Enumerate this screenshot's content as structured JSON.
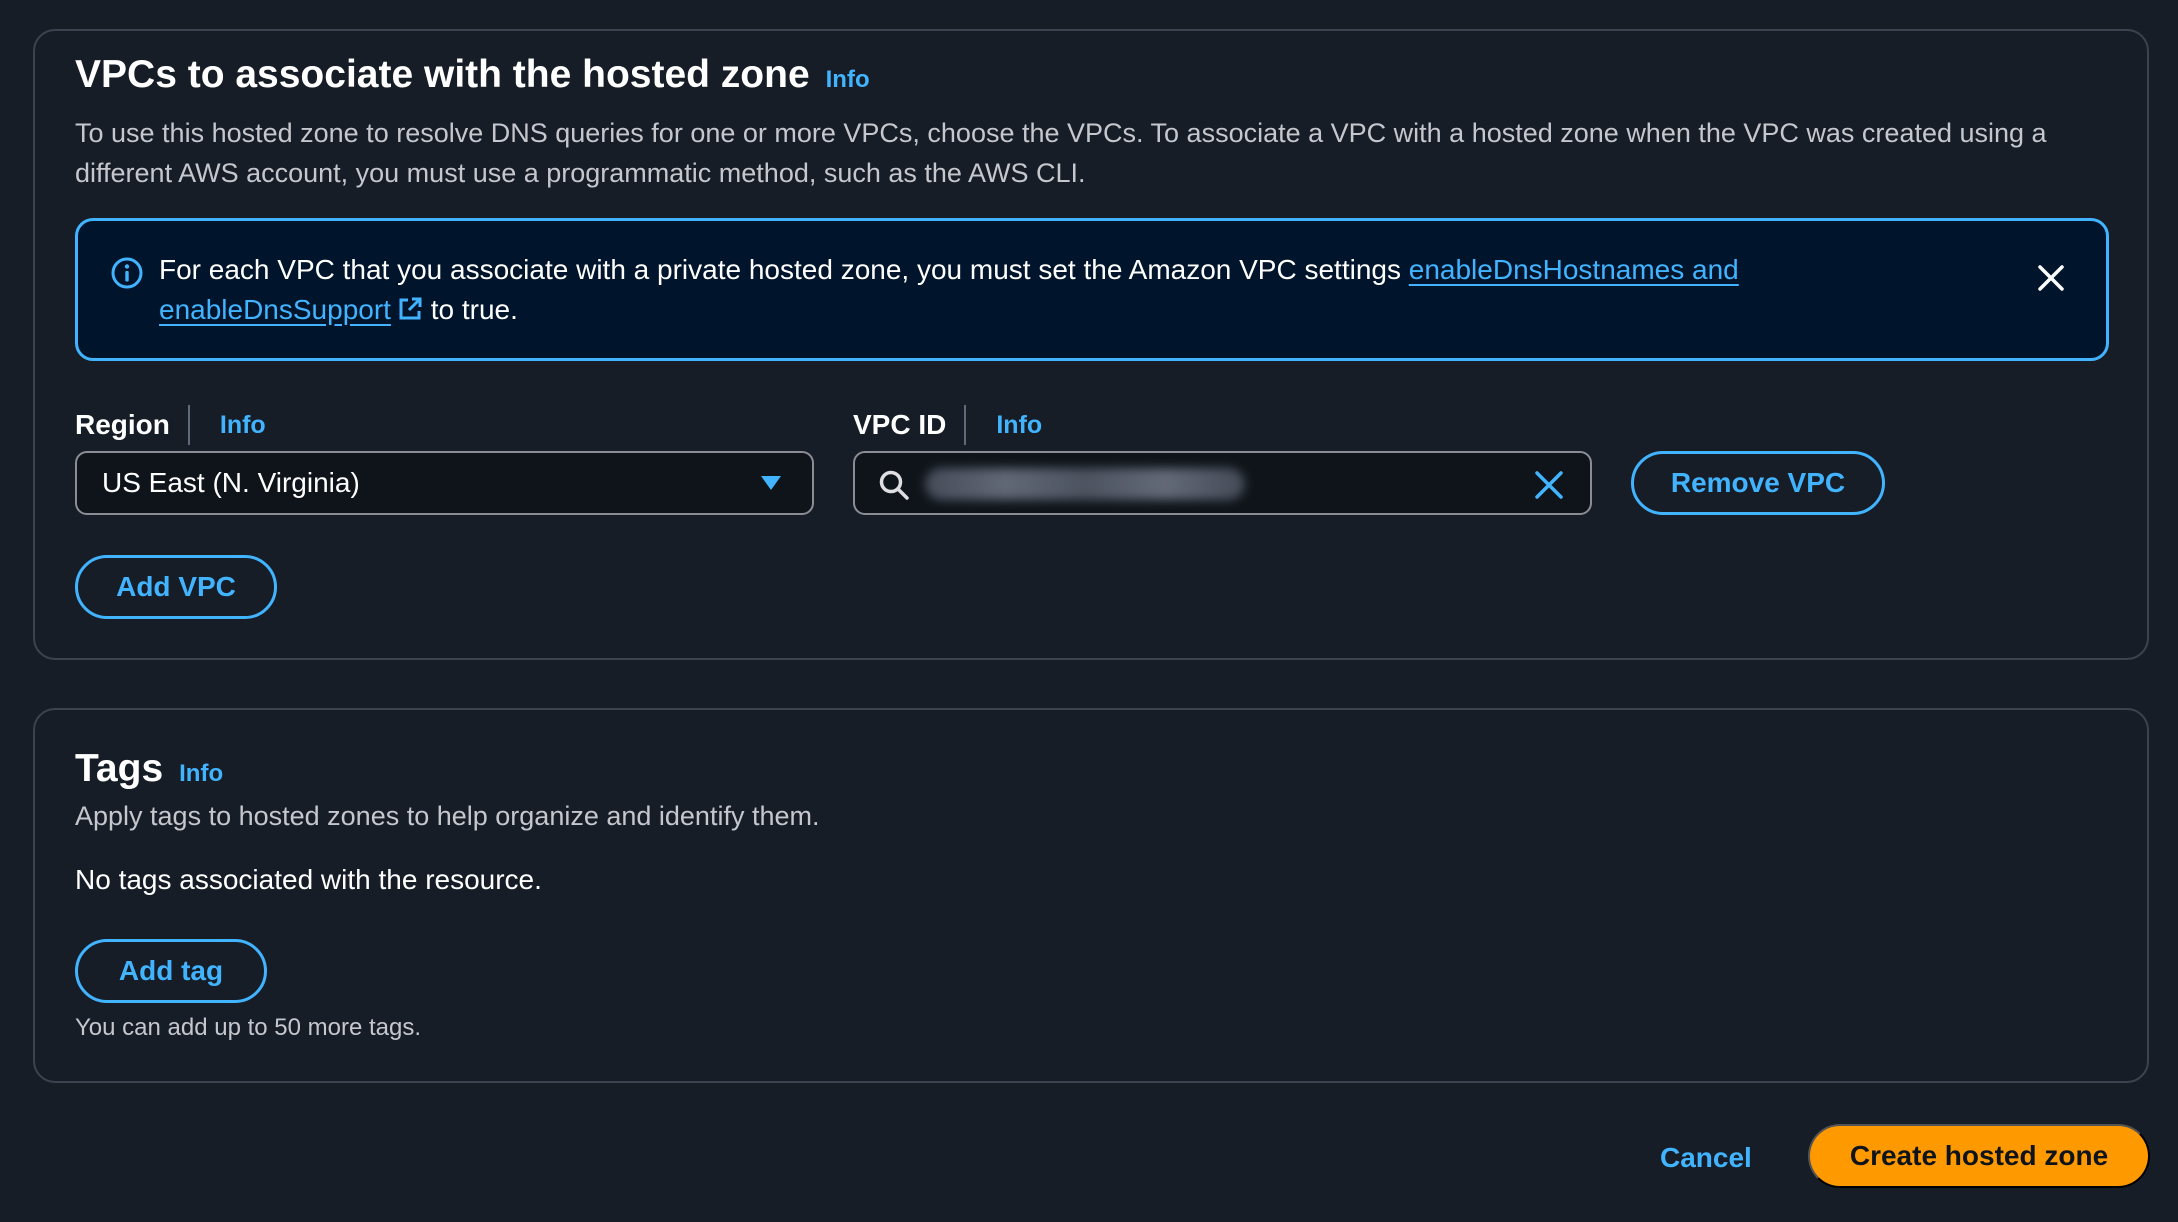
{
  "vpc_section": {
    "title": "VPCs to associate with the hosted zone",
    "info_label": "Info",
    "description": "To use this hosted zone to resolve DNS queries for one or more VPCs, choose the VPCs. To associate a VPC with a hosted zone when the VPC was created using a different AWS account, you must use a programmatic method, such as the AWS CLI.",
    "alert": {
      "text_before": "For each VPC that you associate with a private hosted zone, you must set the Amazon VPC settings ",
      "link_text": "enableDnsHostnames and enableDnsSupport",
      "text_after": " to true."
    },
    "region": {
      "label": "Region",
      "info_label": "Info",
      "selected_value": "US East (N. Virginia)"
    },
    "vpc_id": {
      "label": "VPC ID",
      "info_label": "Info"
    },
    "remove_button": "Remove VPC",
    "add_button": "Add VPC"
  },
  "tags_section": {
    "title": "Tags",
    "info_label": "Info",
    "description": "Apply tags to hosted zones to help organize and identify them.",
    "empty_text": "No tags associated with the resource.",
    "add_button": "Add tag",
    "limit_hint": "You can add up to 50 more tags."
  },
  "footer": {
    "cancel_label": "Cancel",
    "submit_label": "Create hosted zone"
  },
  "colors": {
    "background": "#161d26",
    "accent": "#42b4ff",
    "primary_button": "#ff9900",
    "alert_background": "#00142b"
  },
  "icons": {
    "alert": "info-circle-icon",
    "external_link": "external-link-icon",
    "dismiss": "close-icon",
    "dropdown": "caret-down-icon",
    "search": "search-icon",
    "clear": "clear-icon"
  }
}
